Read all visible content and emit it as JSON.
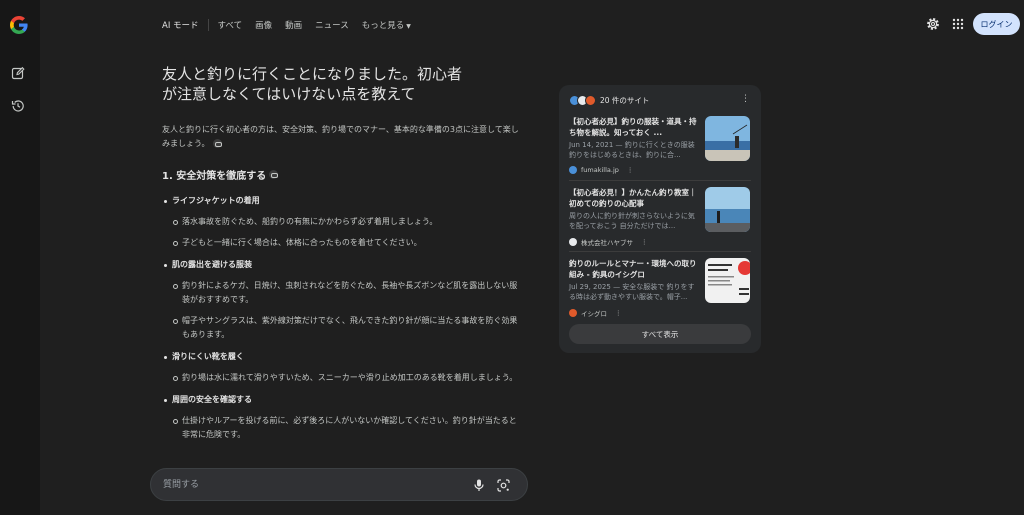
{
  "nav": {
    "items": [
      "AI モード",
      "すべて",
      "画像",
      "動画",
      "ニュース",
      "もっと見る"
    ],
    "login": "ログイン"
  },
  "query": "友人と釣りに行くことになりました。初心者が注意しなくてはいけない点を教えて",
  "intro": "友人と釣りに行く初心者の方は、安全対策、釣り場でのマナー、基本的な準備の3点に注意して楽しみましょう。",
  "section1": {
    "heading": "1. 安全対策を徹底する",
    "groups": [
      {
        "title": "ライフジャケットの着用",
        "items": [
          "落水事故を防ぐため、船釣りの有無にかかわらず必ず着用しましょう。",
          "子どもと一緒に行く場合は、体格に合ったものを着せてください。"
        ]
      },
      {
        "title": "肌の露出を避ける服装",
        "items": [
          "釣り針によるケガ、日焼け、虫刺されなどを防ぐため、長袖や長ズボンなど肌を露出しない服装がおすすめです。",
          "帽子やサングラスは、紫外線対策だけでなく、飛んできた釣り針が顔に当たる事故を防ぐ効果もあります。"
        ]
      },
      {
        "title": "滑りにくい靴を履く",
        "items": [
          "釣り場は水に濡れて滑りやすいため、スニーカーや滑り止め加工のある靴を着用しましょう。"
        ]
      },
      {
        "title": "周囲の安全を確認する",
        "items": [
          "仕掛けやルアーを投げる前に、必ず後ろに人がいないか確認してください。釣り針が当たると非常に危険です。"
        ]
      }
    ]
  },
  "ask": {
    "placeholder": "質問する"
  },
  "sources": {
    "header": "20 件のサイト",
    "show_all": "すべて表示",
    "items": [
      {
        "title": "【初心者必見】釣りの服装・道具・持ち物を解説。知っておく ...",
        "desc": "Jun 14, 2021 — 釣りに行くときの服装 釣りをはじめるときは、釣りに合...",
        "site": "fumakilla.jp"
      },
      {
        "title": "【初心者必見！】かんたん釣り教室｜初めての釣りの心配事",
        "desc": "周りの人に釣り針が刺さらないように気を配っておこう 自分ただけでは...",
        "site": "株式会社ハヤブサ"
      },
      {
        "title": "釣りのルールとマナー・環境への取り組み - 釣具のイシグロ",
        "desc": "Jul 29, 2025 — 安全な服装で 釣りをする時は必ず動きやすい服装で。帽子...",
        "site": "イシグロ"
      }
    ]
  },
  "colors": {
    "background": "#1f1f1f",
    "card": "#282a2c",
    "login_bg": "#d3e3fd"
  },
  "icons": [
    "google-logo-icon",
    "new-chat-icon",
    "history-icon",
    "gear-icon",
    "apps-grid-icon",
    "mic-icon",
    "lens-icon",
    "link-icon",
    "kebab-icon"
  ]
}
